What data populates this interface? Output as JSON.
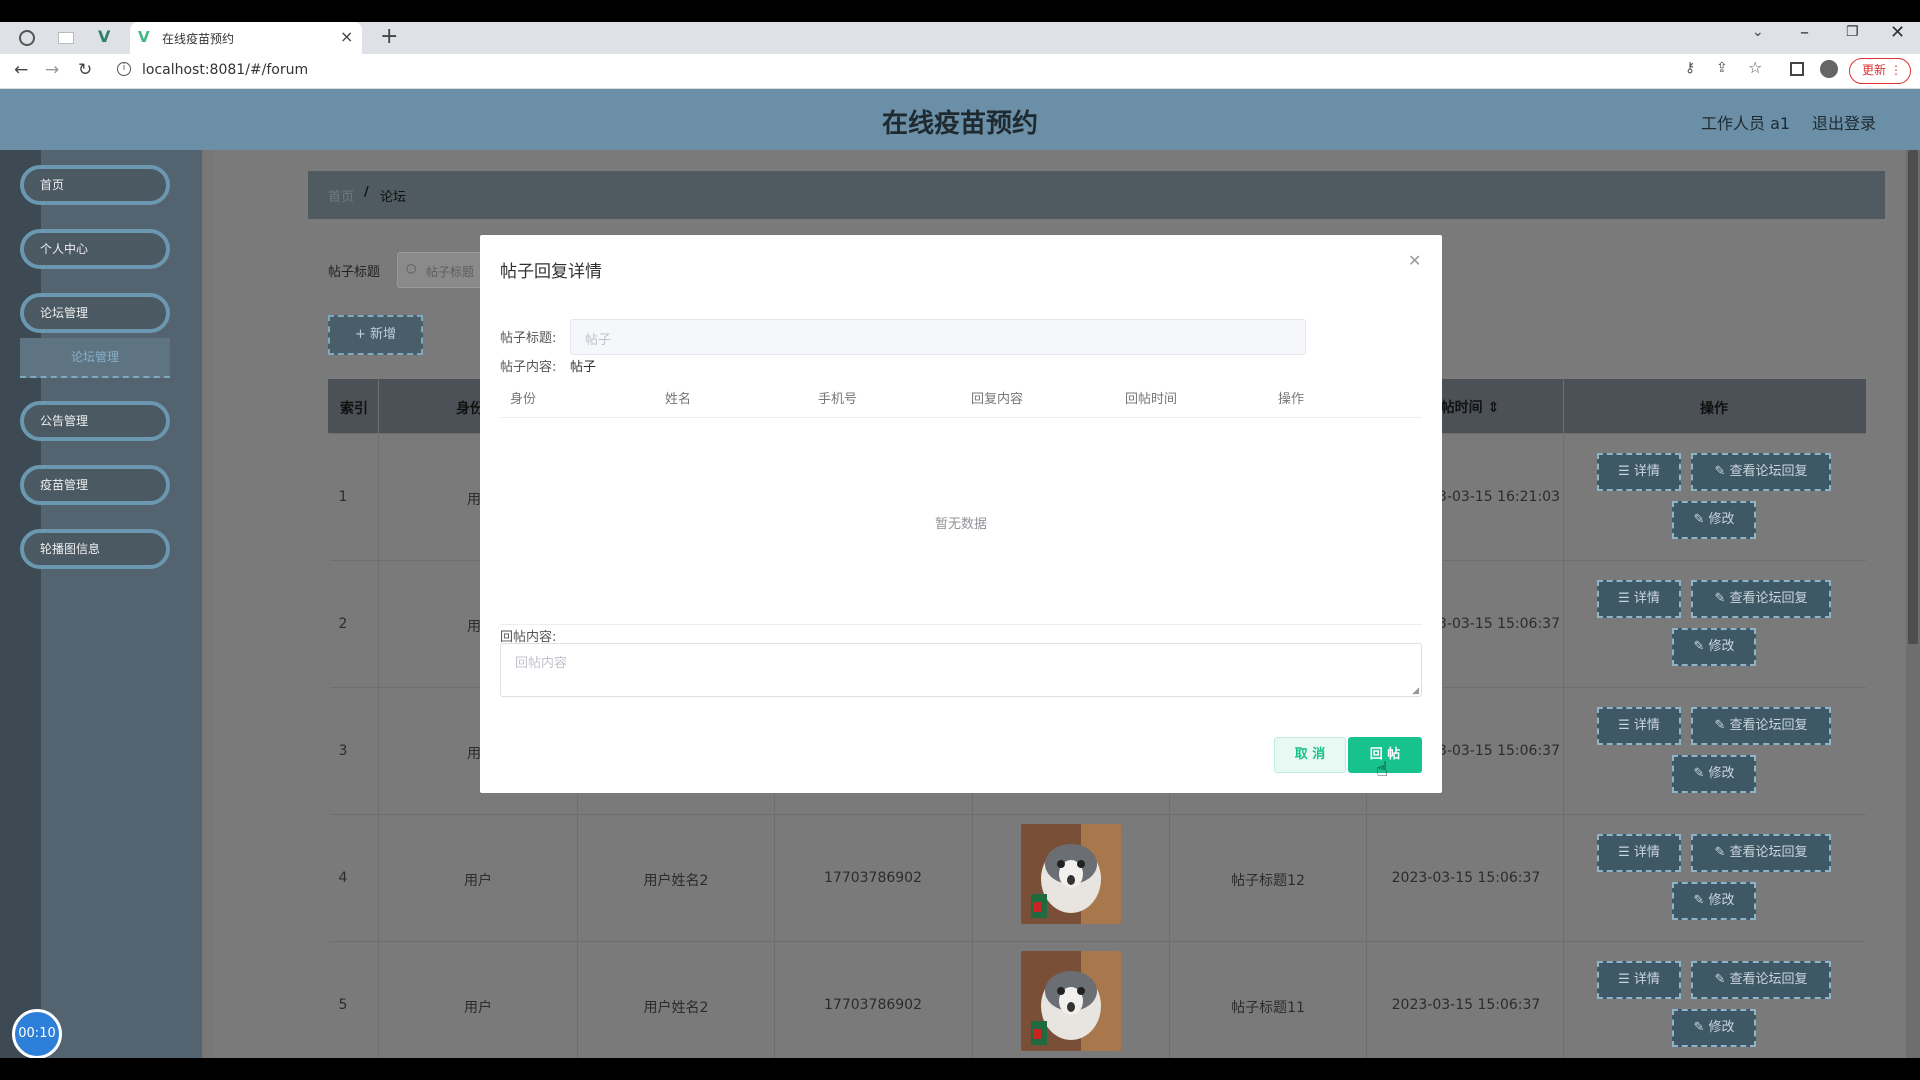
{
  "browser": {
    "tab_title": "在线疫苗预约",
    "url": "localhost:8081/#/forum",
    "update_label": "更新"
  },
  "header": {
    "title": "在线疫苗预约",
    "user_label": "工作人员 a1",
    "logout_label": "退出登录"
  },
  "sidebar": {
    "items": [
      {
        "label": "首页"
      },
      {
        "label": "个人中心"
      },
      {
        "label": "论坛管理"
      },
      {
        "label": "论坛管理"
      },
      {
        "label": "公告管理"
      },
      {
        "label": "疫苗管理"
      },
      {
        "label": "轮播图信息"
      }
    ]
  },
  "breadcrumb": {
    "home": "首页",
    "sep": "/",
    "current": "论坛"
  },
  "search": {
    "label": "帖子标题",
    "placeholder": "帖子标题"
  },
  "add_button": "+ 新增",
  "table": {
    "headers": [
      "索引",
      "身份",
      "帖时间 ⇕",
      "操作"
    ],
    "detail_label": "☰ 详情",
    "reply_label": "✎ 查看论坛回复",
    "edit_label": "✎ 修改",
    "rows": [
      {
        "index": "1",
        "role": "用",
        "name": "",
        "phone": "",
        "title": "",
        "time": "3-03-15 16:21:03"
      },
      {
        "index": "2",
        "role": "用",
        "name": "",
        "phone": "",
        "title": "",
        "time": "3-03-15 15:06:37"
      },
      {
        "index": "3",
        "role": "用",
        "name": "",
        "phone": "",
        "title": "",
        "time": "3-03-15 15:06:37"
      },
      {
        "index": "4",
        "role": "用户",
        "name": "用户姓名2",
        "phone": "17703786902",
        "title": "帖子标题12",
        "time": "2023-03-15 15:06:37"
      },
      {
        "index": "5",
        "role": "用户",
        "name": "用户姓名2",
        "phone": "17703786902",
        "title": "帖子标题11",
        "time": "2023-03-15 15:06:37"
      }
    ]
  },
  "modal": {
    "title": "帖子回复详情",
    "title_label": "帖子标题:",
    "title_placeholder": "帖子",
    "content_label": "帖子内容:",
    "content_value": "帖子",
    "columns": [
      "身份",
      "姓名",
      "手机号",
      "回复内容",
      "回帖时间",
      "操作"
    ],
    "empty_text": "暂无数据",
    "reply_label": "回帖内容:",
    "reply_placeholder": "回帖内容",
    "cancel_label": "取 消",
    "submit_label": "回 帖"
  },
  "timer": "00:10",
  "colors": {
    "header_bg": "#6a8fa6",
    "primary": "#18c28d",
    "sidebar_border": "#6a98b0"
  }
}
